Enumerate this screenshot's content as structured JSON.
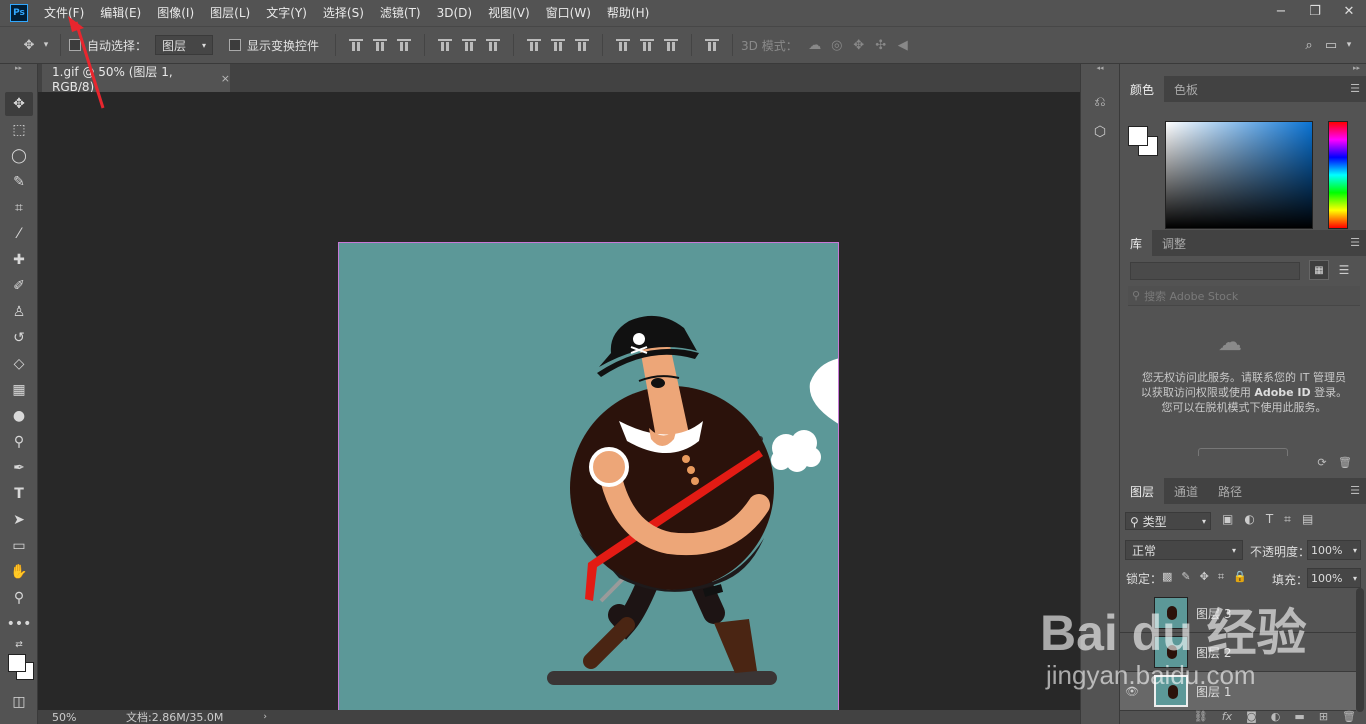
{
  "menubar": {
    "logo": "Ps",
    "items": [
      "文件(F)",
      "编辑(E)",
      "图像(I)",
      "图层(L)",
      "文字(Y)",
      "选择(S)",
      "滤镜(T)",
      "3D(D)",
      "视图(V)",
      "窗口(W)",
      "帮助(H)"
    ],
    "window_controls": [
      "−",
      "❐",
      "✕"
    ]
  },
  "options": {
    "auto_select_label": "自动选择：",
    "auto_select_value": "图层",
    "show_transform_label": "显示变换控件",
    "mode_3d_label": "3D 模式："
  },
  "document": {
    "tab_title": "1.gif @ 50% (图层 1, RGB/8)",
    "close": "×",
    "canvas_bg": "#5c9898",
    "zoom": "50%",
    "doc_size": "文档:2.86M/35.0M"
  },
  "color_panel": {
    "tabs": [
      "颜色",
      "色板"
    ]
  },
  "library_panel": {
    "tabs": [
      "库",
      "调整"
    ],
    "search_placeholder": "搜索 Adobe Stock",
    "message_1": "您无权访问此服务。请联系您的 IT 管理员以获取访问权限或使用 ",
    "message_bold": "Adobe ID",
    "message_2": " 登录。您可以在脱机模式下使用此服务。"
  },
  "layers_panel": {
    "tabs": [
      "图层",
      "通道",
      "路径"
    ],
    "filter_value": "类型",
    "blend_mode": "正常",
    "opacity_label": "不透明度：",
    "opacity_value": "100%",
    "lock_label": "锁定：",
    "fill_label": "填充：",
    "fill_value": "100%",
    "layers": [
      {
        "name": "图层 3"
      },
      {
        "name": "图层 2"
      },
      {
        "name": "图层 1"
      }
    ]
  },
  "watermark": {
    "brand": "Bai du 经验",
    "url": "jingyan.baidu.com"
  },
  "colors": {
    "annotation": "#e8262e",
    "selection_border": "#c879d6"
  }
}
